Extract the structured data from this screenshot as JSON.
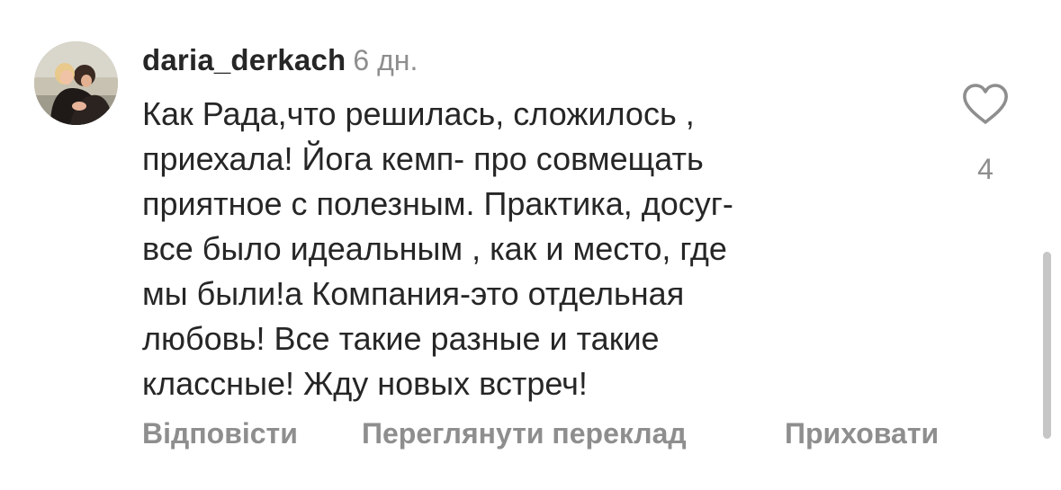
{
  "comment": {
    "username": "daria_derkach",
    "time": "6 дн.",
    "text_lines": [
      "Как Рада,что решилась, сложилось ,",
      "приехала! Йога кемп- про совмещать",
      "приятное с полезным. Практика, досуг-",
      "все было идеальным , как и место, где",
      "мы были!а Компания-это отдельная",
      "любовь! Все такие разные и такие",
      "классные! Жду новых встреч!"
    ],
    "like_icon": "heart-outline-icon",
    "like_count": "4"
  },
  "actions": {
    "reply_label": "Відповісти",
    "translate_label": "Переглянути переклад",
    "hide_label": "Приховати"
  },
  "colors": {
    "primary_text": "#262626",
    "secondary_text": "#8e8e8e",
    "scrollbar": "#c6c6c6"
  }
}
